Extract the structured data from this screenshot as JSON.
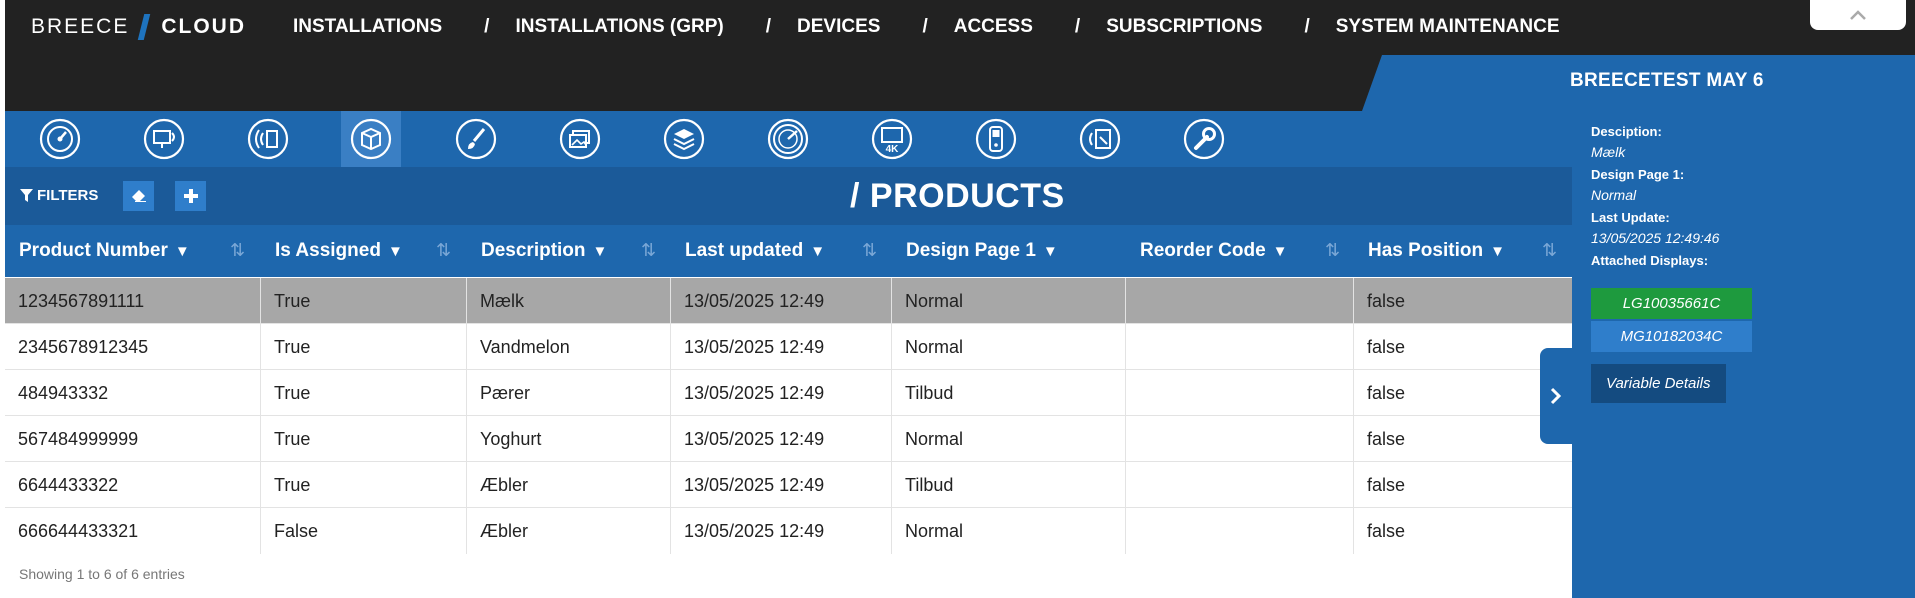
{
  "brand": {
    "part1": "BREECE",
    "part2": "CLOUD"
  },
  "nav": [
    "INSTALLATIONS",
    "INSTALLATIONS (GRP)",
    "DEVICES",
    "ACCESS",
    "SUBSCRIPTIONS",
    "SYSTEM MAINTENANCE"
  ],
  "nav_separator": "/",
  "right_panel": {
    "title": "BREECETEST MAY 6",
    "description_label": "Desciption:",
    "description_value": "Mælk",
    "design_label": "Design Page 1:",
    "design_value": "Normal",
    "update_label": "Last Update:",
    "update_value": "13/05/2025 12:49:46",
    "displays_label": "Attached Displays:",
    "displays": [
      "LG10035661C",
      "MG10182034C"
    ],
    "variable_button": "Variable Details"
  },
  "icons": [
    "dashboard-icon",
    "screen-signal-icon",
    "broadcast-icon",
    "products-box-icon",
    "brush-icon",
    "images-icon",
    "layers-icon",
    "gauge-icon",
    "monitor-4k-icon",
    "handheld-device-icon",
    "tablet-signal-icon",
    "wrench-icon"
  ],
  "filters_label": "FILTERS",
  "page_title": "/ PRODUCTS",
  "columns": [
    "Product Number",
    "Is Assigned",
    "Description",
    "Last updated",
    "Design Page 1",
    "Reorder Code",
    "Has Position"
  ],
  "rows": [
    [
      "1234567891111",
      "True",
      "Mælk",
      "13/05/2025 12:49",
      "Normal",
      "",
      "false"
    ],
    [
      "2345678912345",
      "True",
      "Vandmelon",
      "13/05/2025 12:49",
      "Normal",
      "",
      "false"
    ],
    [
      "484943332",
      "True",
      "Pærer",
      "13/05/2025 12:49",
      "Tilbud",
      "",
      "false"
    ],
    [
      "567484999999",
      "True",
      "Yoghurt",
      "13/05/2025 12:49",
      "Normal",
      "",
      "false"
    ],
    [
      "6644433322",
      "True",
      "Æbler",
      "13/05/2025 12:49",
      "Tilbud",
      "",
      "false"
    ],
    [
      "666644433321",
      "False",
      "Æbler",
      "13/05/2025 12:49",
      "Normal",
      "",
      "false"
    ]
  ],
  "footer": "Showing 1 to 6 of 6 entries",
  "colors": {
    "topbar": "#222222",
    "primary": "#1e67ad",
    "filterbar": "#1b5a99",
    "green": "#1e9a3e",
    "selected_row": "#a7a7a7"
  }
}
